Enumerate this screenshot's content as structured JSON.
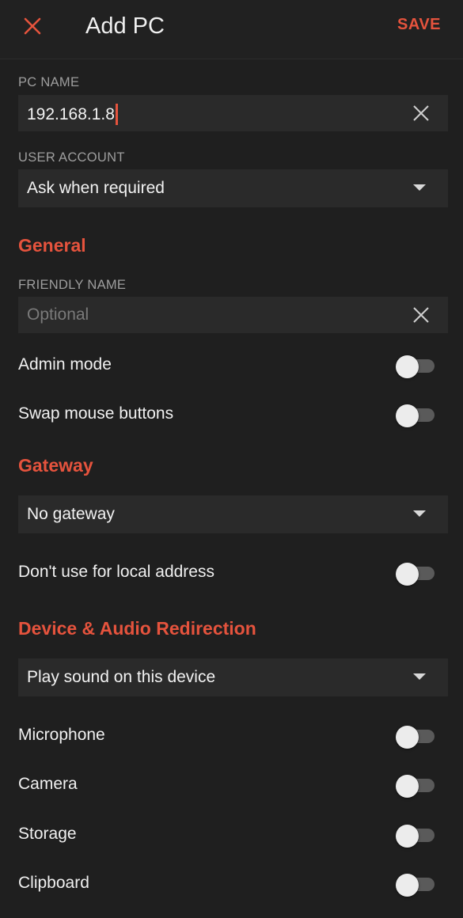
{
  "header": {
    "title": "Add PC",
    "save_label": "SAVE"
  },
  "pc_name": {
    "label": "PC NAME",
    "value": "192.168.1.8"
  },
  "user_account": {
    "label": "USER ACCOUNT",
    "selected": "Ask when required"
  },
  "general": {
    "header": "General",
    "friendly_name": {
      "label": "FRIENDLY NAME",
      "placeholder": "Optional",
      "value": ""
    },
    "admin_mode": {
      "label": "Admin mode",
      "on": false
    },
    "swap_mouse": {
      "label": "Swap mouse buttons",
      "on": false
    }
  },
  "gateway": {
    "header": "Gateway",
    "selected": "No gateway",
    "local_address": {
      "label": "Don't use for local address",
      "on": false
    }
  },
  "redirection": {
    "header": "Device & Audio Redirection",
    "sound_selected": "Play sound on this device",
    "microphone": {
      "label": "Microphone",
      "on": false
    },
    "camera": {
      "label": "Camera",
      "on": false
    },
    "storage": {
      "label": "Storage",
      "on": false
    },
    "clipboard": {
      "label": "Clipboard",
      "on": false
    }
  },
  "colors": {
    "accent": "#e5533d",
    "background": "#1f1f1f",
    "field": "#2a2a2a"
  },
  "icons": {
    "close": "close-icon",
    "clear": "clear-icon",
    "dropdown": "chevron-down-icon"
  }
}
